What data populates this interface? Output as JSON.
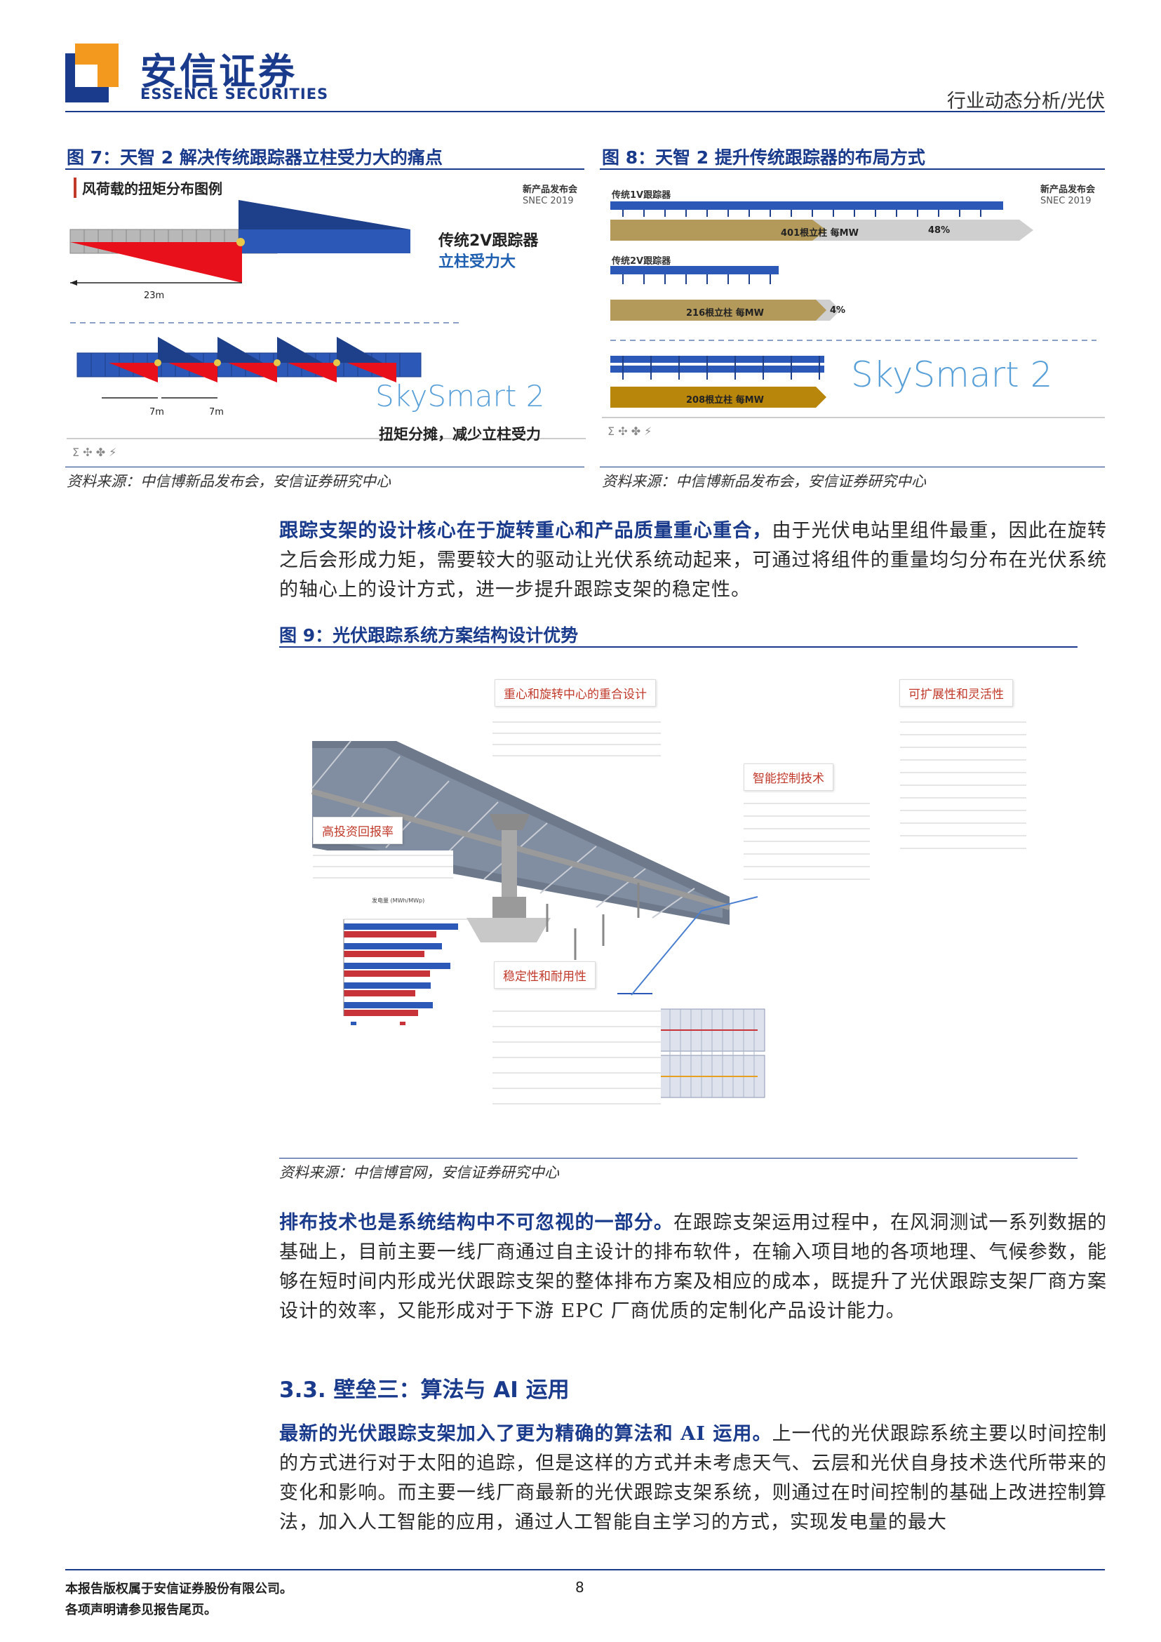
{
  "header": {
    "logo_cn": "安信证券",
    "logo_en": "ESSENCE SECURITIES",
    "category": "行业动态分析/光伏",
    "brand_color": "#1a3a8c"
  },
  "figure7": {
    "title": "图 7：天智 2 解决传统跟踪器立柱受力大的痛点",
    "image": {
      "heading": "风荷载的扭矩分布图例",
      "snec_line1": "新产品发布会",
      "snec_line2": "SNEC 2019",
      "legacy_label_1": "传统2V跟踪器",
      "legacy_label_2": "立柱受力大",
      "span_23m": "23m",
      "span_7m_a": "7m",
      "span_7m_b": "7m",
      "product": "SkySmart 2",
      "caption": "扭矩分摊，减少立柱受力"
    },
    "source": "资料来源：中信博新品发布会，安信证券研究中心"
  },
  "figure8": {
    "title": "图 8：天智 2 提升传统跟踪器的布局方式",
    "image": {
      "snec_line1": "新产品发布会",
      "snec_line2": "SNEC 2019",
      "row1_label": "传统1V跟踪器",
      "row1_bar": "401根立柱 每MW",
      "row1_pct": "48%",
      "row2_label": "传统2V跟踪器",
      "row2_bar": "216根立柱 每MW",
      "row2_pct": "4%",
      "row3_bar": "208根立柱 每MW",
      "product": "SkySmart 2"
    },
    "source": "资料来源：中信博新品发布会，安信证券研究中心"
  },
  "para1": {
    "bold": "跟踪支架的设计核心在于旋转重心和产品质量重心重合，",
    "text": "由于光伏电站里组件最重，因此在旋转之后会形成力矩，需要较大的驱动让光伏系统动起来，可通过将组件的重量均匀分布在光伏系统的轴心上的设计方式，进一步提升跟踪支架的稳定性。"
  },
  "figure9": {
    "title": "图 9：光伏跟踪系统方案结构设计优势",
    "tags": {
      "center": "重心和旋转中心的重合设计",
      "scalable": "可扩展性和灵活性",
      "control": "智能控制技术",
      "roi": "高投资回报率",
      "stability": "稳定性和耐用性"
    },
    "source": "资料来源：中信博官网，安信证券研究中心"
  },
  "para2": {
    "bold": "排布技术也是系统结构中不可忽视的一部分。",
    "text": "在跟踪支架运用过程中，在风洞测试一系列数据的基础上，目前主要一线厂商通过自主设计的排布软件，在输入项目地的各项地理、气候参数，能够在短时间内形成光伏跟踪支架的整体排布方案及相应的成本，既提升了光伏跟踪支架厂商方案设计的效率，又能形成对于下游 EPC 厂商优质的定制化产品设计能力。"
  },
  "section": {
    "title": "3.3. 壁垒三：算法与 AI 运用"
  },
  "para3": {
    "bold": "最新的光伏跟踪支架加入了更为精确的算法和 AI 运用。",
    "text": "上一代的光伏跟踪系统主要以时间控制的方式进行对于太阳的追踪，但是这样的方式并未考虑天气、云层和光伏自身技术迭代所带来的变化和影响。而主要一线厂商最新的光伏跟踪支架系统，则通过在时间控制的基础上改进控制算法，加入人工智能的应用，通过人工智能自主学习的方式，实现发电量的最大"
  },
  "footer": {
    "line1": "本报告版权属于安信证券股份有限公司。",
    "line2": "各项声明请参见报告尾页。",
    "page_number": "8"
  }
}
